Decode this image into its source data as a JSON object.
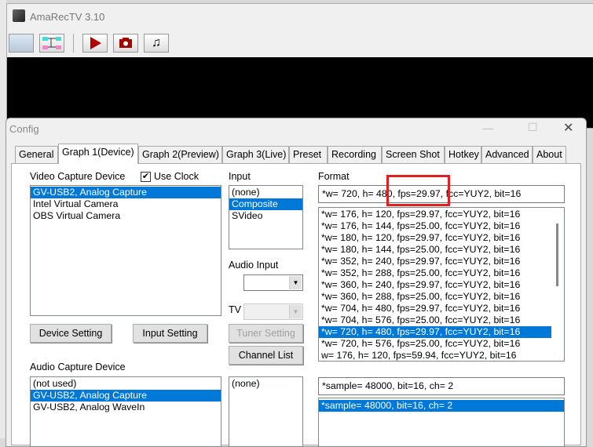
{
  "main_window": {
    "title": "AmaRecTV 3.10",
    "toolbar": [
      "config-window",
      "graph-editor",
      "play",
      "screenshot",
      "audio"
    ]
  },
  "config": {
    "title": "Config",
    "tabs": [
      "General",
      "Graph 1(Device)",
      "Graph 2(Preview)",
      "Graph 3(Live)",
      "Preset",
      "Recording",
      "Screen Shot",
      "Hotkey",
      "Advanced",
      "About"
    ],
    "selected_tab": "Graph 1(Device)",
    "video_capture_label": "Video Capture Device",
    "use_clock_label": "Use Clock",
    "use_clock_checked": true,
    "video_devices": [
      "GV-USB2, Analog Capture",
      "Intel Virtual Camera",
      "OBS Virtual Camera"
    ],
    "input_label": "Input",
    "inputs": [
      "(none)",
      "Composite",
      "SVideo"
    ],
    "audio_input_label": "Audio Input",
    "tv_label": "TV",
    "tuner_setting": "Tuner Setting",
    "channel_list": "Channel List",
    "device_setting": "Device Setting",
    "input_setting": "Input Setting",
    "format_label": "Format",
    "format_value": "*w= 720, h= 480, fps=29.97,  fcc=YUY2, bit=16",
    "formats": [
      "*w= 176, h= 120, fps=29.97,  fcc=YUY2, bit=16",
      "*w= 176, h= 144, fps=25.00,  fcc=YUY2, bit=16",
      "*w= 180, h= 120, fps=29.97,  fcc=YUY2, bit=16",
      "*w= 180, h= 144, fps=25.00,  fcc=YUY2, bit=16",
      "*w= 352, h= 240, fps=29.97,  fcc=YUY2, bit=16",
      "*w= 352, h= 288, fps=25.00,  fcc=YUY2, bit=16",
      "*w= 360, h= 240, fps=29.97,  fcc=YUY2, bit=16",
      "*w= 360, h= 288, fps=25.00,  fcc=YUY2, bit=16",
      "*w= 704, h= 480, fps=29.97,  fcc=YUY2, bit=16",
      "*w= 704, h= 576, fps=25.00,  fcc=YUY2, bit=16",
      "*w= 720, h= 480, fps=29.97,  fcc=YUY2, bit=16",
      "*w= 720, h= 576, fps=25.00,  fcc=YUY2, bit=16",
      "w= 176, h= 120, fps=59.94,  fcc=YUY2, bit=16"
    ],
    "audio_capture_label": "Audio Capture Device",
    "audio_devices": [
      "(not used)",
      "GV-USB2, Analog Capture",
      "GV-USB2, Analog WaveIn"
    ],
    "audio_inputs": [
      "(none)"
    ],
    "audio_format_value": "*sample= 48000, bit=16, ch= 2",
    "audio_formats": [
      "*sample= 48000, bit=16, ch= 2"
    ]
  },
  "colors": {
    "selection": "#0078d7",
    "highlight_box": "#e02020"
  }
}
